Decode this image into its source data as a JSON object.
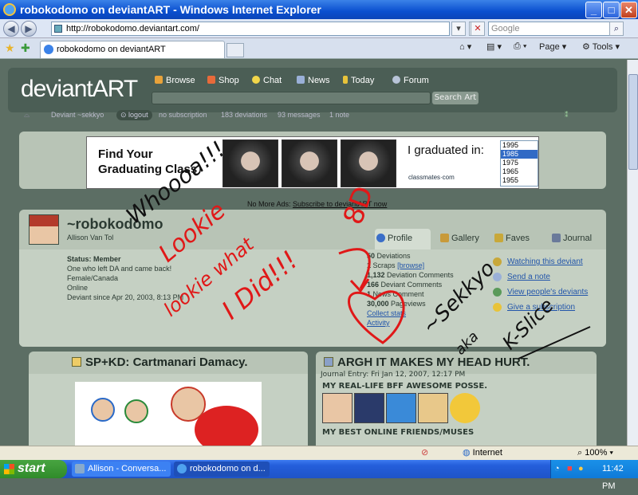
{
  "window": {
    "title": "robokodomo on deviantART - Windows Internet Explorer",
    "minimize": "_",
    "maximize": "□",
    "close": "✕"
  },
  "addressbar": {
    "url": "http://robokodomo.deviantart.com/",
    "search_placeholder": "Google",
    "back_icon": "back-arrow-icon",
    "forward_icon": "forward-arrow-icon"
  },
  "tabbar": {
    "tab_title": "robokodomo on deviantART",
    "tools": [
      "Page",
      "Tools"
    ]
  },
  "deviantart": {
    "logo": "deviantART",
    "nav": [
      {
        "label": "Browse",
        "color": "#e8a23a"
      },
      {
        "label": "Shop",
        "color": "#e86a3a"
      },
      {
        "label": "Chat",
        "color": "#f2d64a"
      },
      {
        "label": "News",
        "color": "#9ab0d8"
      },
      {
        "label": "Today",
        "color": "#e8c33a"
      },
      {
        "label": "Forum",
        "color": "#b8c4d8"
      }
    ],
    "search_button": "Search Art",
    "userbar": {
      "user": "Deviant ~sekkyo",
      "logout": "logout",
      "subscription": "no subscription",
      "deviations": "183 deviations",
      "messages": "93 messages",
      "notes": "1 note"
    }
  },
  "ad": {
    "headline": "Find Your Graduating Class",
    "graduated": "I graduated in:",
    "years": [
      "1995",
      "1985",
      "1975",
      "1965",
      "1955"
    ],
    "selected_year": "1985",
    "brand": "classmates·com",
    "no_more_ads": "No More Ads:",
    "subscribe_link": "Subscribe to deviantART now"
  },
  "profile": {
    "username": "~robokodomo",
    "title_text": "Allison Van Tol",
    "tabs": [
      "Profile",
      "Gallery",
      "Faves",
      "Journal"
    ],
    "status_lines": [
      "Status: Member",
      "One who left DA and came back!",
      "Female/Canada",
      "Online",
      "Deviant since Apr 20, 2003, 8:13 PM"
    ],
    "stats": [
      {
        "num": "50",
        "label": "Deviations"
      },
      {
        "num": "1",
        "label": "Scraps",
        "link": "[browse]"
      },
      {
        "num": "1,132",
        "label": "Deviation Comments"
      },
      {
        "num": "166",
        "label": "Deviant Comments"
      },
      {
        "num": "1",
        "label": "News Comment"
      },
      {
        "num": "30,000",
        "label": "Pageviews"
      }
    ],
    "stat_links": [
      "Collect stats",
      "Activity"
    ],
    "links": [
      "Watching this deviant",
      "Send a note",
      "View people's deviants",
      "Give a subscription"
    ]
  },
  "boxes": {
    "left_title": "SP+KD: Cartmanari Damacy.",
    "right_title": "ARGH IT MAKES MY HEAD HURT.",
    "journal_date": "Journal Entry: Fri Jan 12, 2007, 12:17 PM",
    "posse": "MY REAL-LIFE BFF AWESOME POSSE.",
    "best_online": "MY BEST ONLINE FRIENDS/MUSES"
  },
  "scrawl": {
    "line1": "Whoooa!!!",
    "line2": "Lookie",
    "line3": "lookie what",
    "line4": "I Did!!!",
    "face": "8D",
    "sig1": "~Sekkyo",
    "sig2": "aka",
    "sig3": "K-Slice"
  },
  "statusbar": {
    "zone": "Internet",
    "zoom": "100%"
  },
  "taskbar": {
    "start": "start",
    "tasks": [
      "Allison - Conversa...",
      "robokodomo on d..."
    ],
    "clock": "11:42 PM"
  }
}
